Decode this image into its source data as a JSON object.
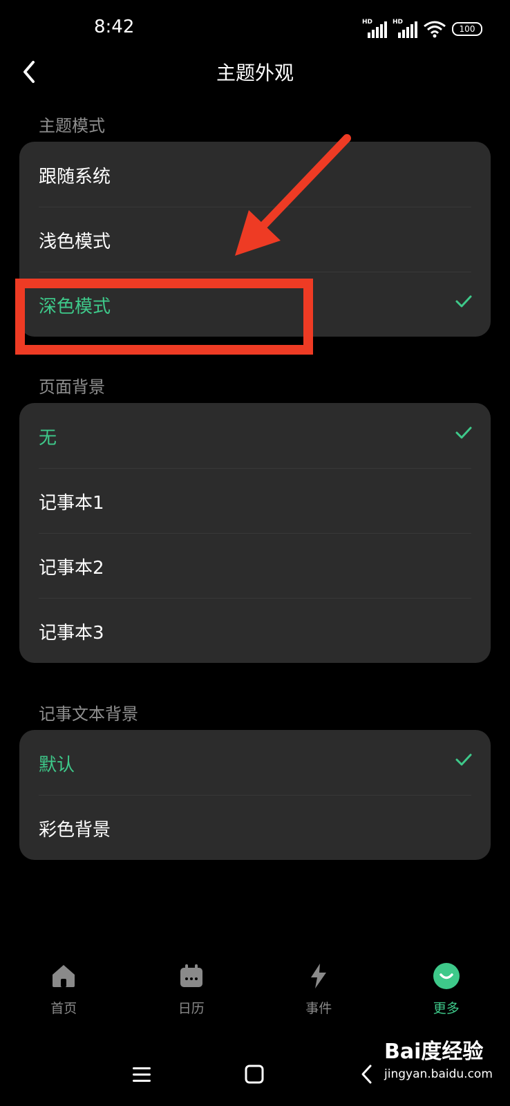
{
  "status_bar": {
    "time": "8:42",
    "battery": "100",
    "signal_labels": [
      "HD",
      "HD"
    ]
  },
  "header": {
    "title": "主题外观"
  },
  "sections": [
    {
      "label": "主题模式",
      "items": [
        {
          "label": "跟随系统",
          "selected": false
        },
        {
          "label": "浅色模式",
          "selected": false
        },
        {
          "label": "深色模式",
          "selected": true
        }
      ]
    },
    {
      "label": "页面背景",
      "items": [
        {
          "label": "无",
          "selected": true
        },
        {
          "label": "记事本1",
          "selected": false
        },
        {
          "label": "记事本2",
          "selected": false
        },
        {
          "label": "记事本3",
          "selected": false
        }
      ]
    },
    {
      "label": "记事文本背景",
      "items": [
        {
          "label": "默认",
          "selected": true
        },
        {
          "label": "彩色背景",
          "selected": false
        }
      ]
    }
  ],
  "tab_bar": {
    "tabs": [
      {
        "label": "首页",
        "icon": "home-icon",
        "active": false
      },
      {
        "label": "日历",
        "icon": "calendar-icon",
        "active": false
      },
      {
        "label": "事件",
        "icon": "lightning-icon",
        "active": false
      },
      {
        "label": "更多",
        "icon": "more-smile-icon",
        "active": true
      }
    ]
  },
  "watermark": {
    "logo": "Bai度经验",
    "url": "jingyan.baidu.com"
  },
  "colors": {
    "accent": "#3ec98a",
    "annotation": "#ee3b24",
    "card": "#2c2c2c",
    "background": "#000000"
  }
}
